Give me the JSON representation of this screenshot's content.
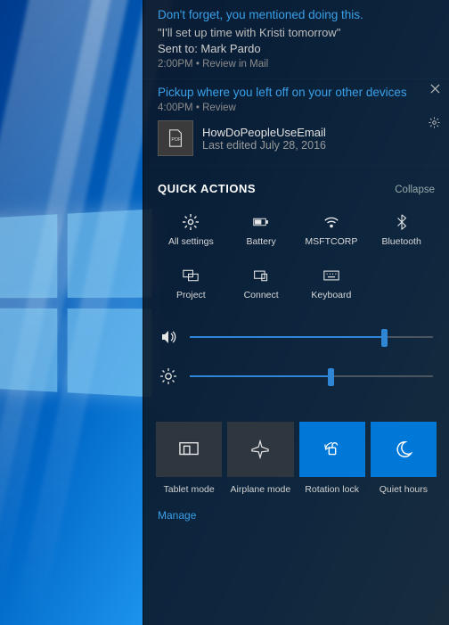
{
  "notifs": [
    {
      "title": "Don't forget, you mentioned doing this.",
      "quote": "\"I'll set up time with Kristi tomorrow\"",
      "sent": "Sent to: Mark Pardo",
      "time": "2:00PM",
      "review": "Review in Mail"
    },
    {
      "title": "Pickup where you left off on your other devices",
      "time": "4:00PM",
      "review": "Review",
      "file": "HowDoPeopleUseEmail",
      "edited": "Last edited July 28, 2016"
    }
  ],
  "qa": {
    "title": "QUICK ACTIONS",
    "collapse": "Collapse",
    "items": [
      "All settings",
      "Battery",
      "MSFTCORP",
      "Bluetooth",
      "Project",
      "Connect",
      "Keyboard"
    ]
  },
  "sliders": {
    "volume": 80,
    "brightness": 58
  },
  "tiles": {
    "items": [
      "Tablet mode",
      "Airplane mode",
      "Rotation lock",
      "Quiet hours"
    ],
    "active": [
      false,
      false,
      true,
      true
    ]
  },
  "manage": "Manage"
}
